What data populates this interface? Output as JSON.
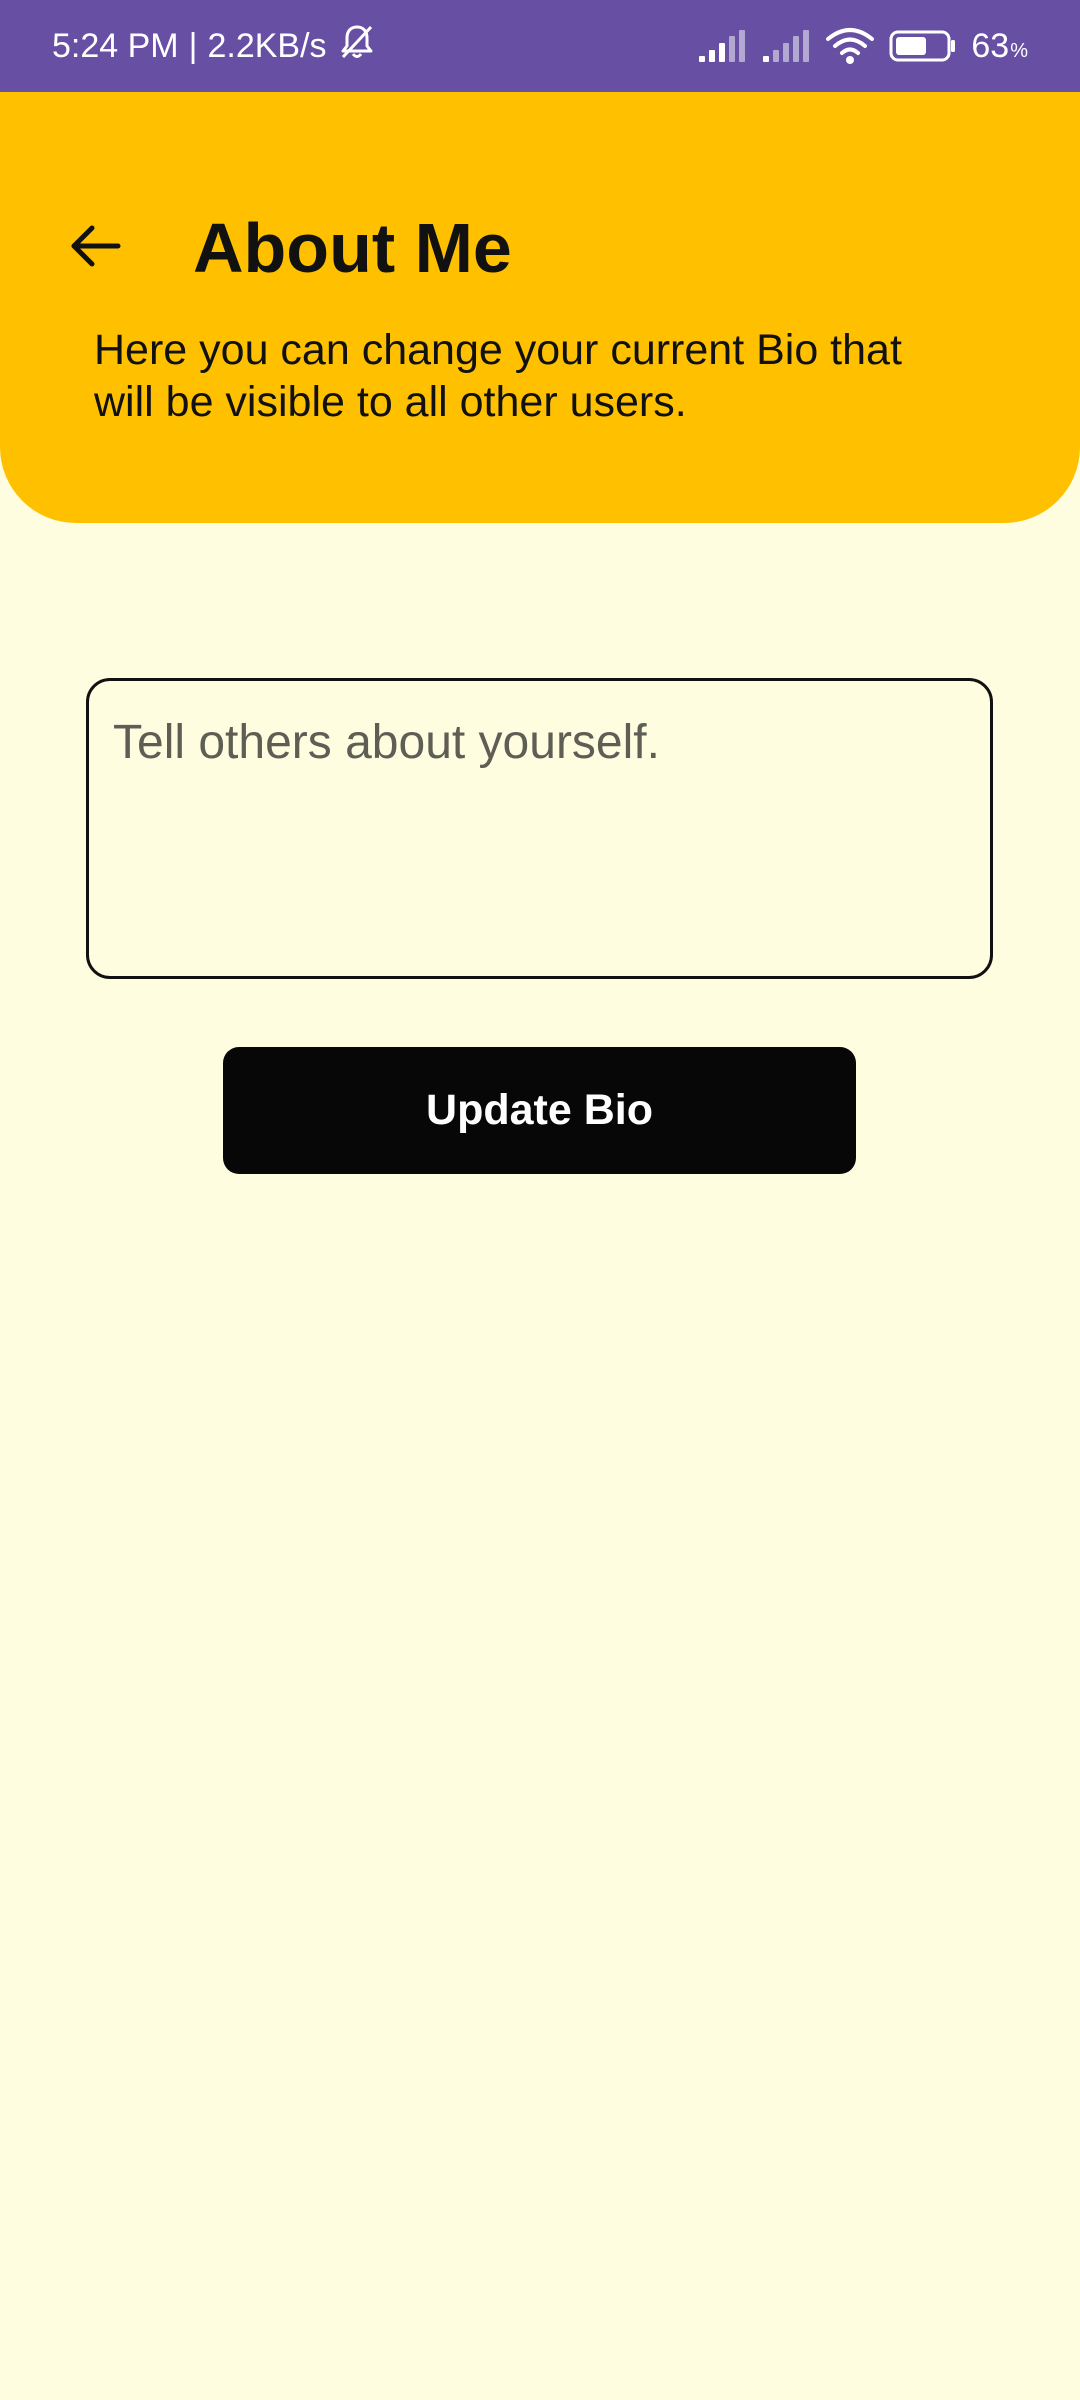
{
  "status_bar": {
    "time": "5:24 PM",
    "separator": "|",
    "network_speed": "2.2KB/s",
    "battery_value": "63",
    "battery_unit": "%",
    "battery_level": 0.63,
    "icons": [
      "mute-bell-icon",
      "signal-icon",
      "signal-icon",
      "wifi-icon",
      "battery-icon"
    ],
    "background_color": "#6750A4"
  },
  "header": {
    "title": "About Me",
    "subtitle": "Here you can change your current Bio that will be visible to all other users.",
    "back_icon": "arrow-back-icon",
    "background_color": "#FFC000"
  },
  "bio": {
    "value": "",
    "placeholder": "Tell others about yourself."
  },
  "actions": {
    "update_label": "Update Bio",
    "button_color": "#070707"
  },
  "page": {
    "background_color": "#FEFDE0"
  }
}
